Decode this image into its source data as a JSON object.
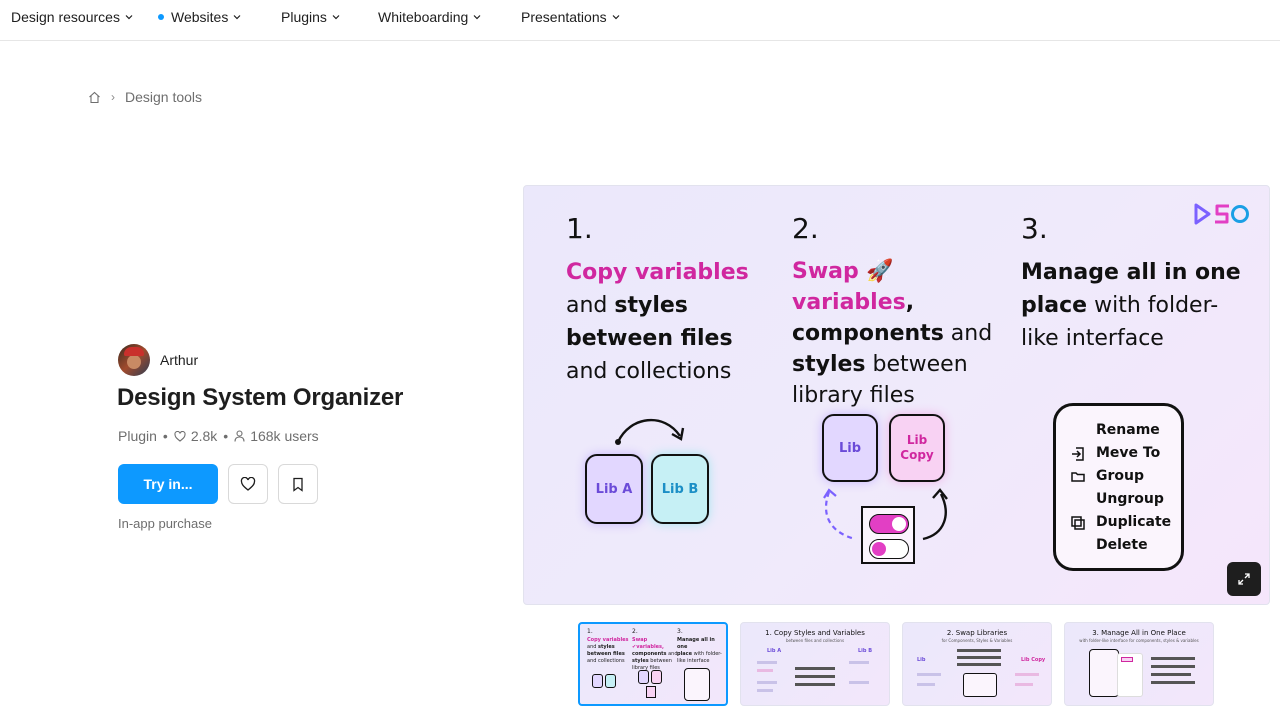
{
  "nav": {
    "items": [
      {
        "label": "Design resources"
      },
      {
        "label": "Websites"
      },
      {
        "label": "Plugins"
      },
      {
        "label": "Whiteboarding"
      },
      {
        "label": "Presentations"
      }
    ]
  },
  "breadcrumb": {
    "current": "Design tools"
  },
  "plugin": {
    "author": "Arthur",
    "title": "Design System Organizer",
    "type": "Plugin",
    "likes": "2.8k",
    "users": "168k users",
    "try_label": "Try in...",
    "purchase_note": "In-app purchase"
  },
  "hero": {
    "logo": "DSO",
    "col1": {
      "num": "1.",
      "line1": "Copy variables",
      "line2a": "and ",
      "line2b": "styles",
      "line3": "between files",
      "line4": "and collections",
      "lib_a": "Lib A",
      "lib_b": "Lib B"
    },
    "col2": {
      "num": "2.",
      "line1a": "Swap ",
      "line1b": "🚀",
      "line1c": "variables",
      "line1d": ",",
      "line2a": "components",
      "line2b": " and",
      "line3a": "styles",
      "line3b": " between",
      "line4": "library files",
      "lib": "Lib",
      "lib_copy_1": "Lib",
      "lib_copy_2": "Copy"
    },
    "col3": {
      "num": "3.",
      "line1": "Manage all in one",
      "line2a": "place",
      "line2b": " with folder-",
      "line3": "like interface",
      "menu": [
        "Rename",
        "Meve To",
        "Group",
        "Ungroup",
        "Duplicate",
        "Delete"
      ]
    }
  },
  "thumbnails": [
    {
      "title": "",
      "sub": "",
      "c1": "1.",
      "c2": "2.",
      "c3": "3.",
      "t1": "Copy variables",
      "t2": "Swap ✔variables,",
      "t3": "Manage all in one"
    },
    {
      "title": "1. Copy Styles and Variables",
      "sub": "between files and collections",
      "lib_a": "Lib A",
      "lib_b": "Lib B"
    },
    {
      "title": "2. Swap Libraries",
      "sub2": "for Components, Styles & Variables",
      "lib": "Lib",
      "lib_copy": "Lib Copy"
    },
    {
      "title": "3. Manage All in One Place",
      "sub": "with folder-like interface for components, styles & variables"
    }
  ],
  "colors": {
    "accent": "#0d99ff",
    "magenta": "#d0279f",
    "lib_a": "#e2d7ff",
    "lib_b": "#c6f0f5",
    "lib_copy": "#f8d2f3"
  }
}
